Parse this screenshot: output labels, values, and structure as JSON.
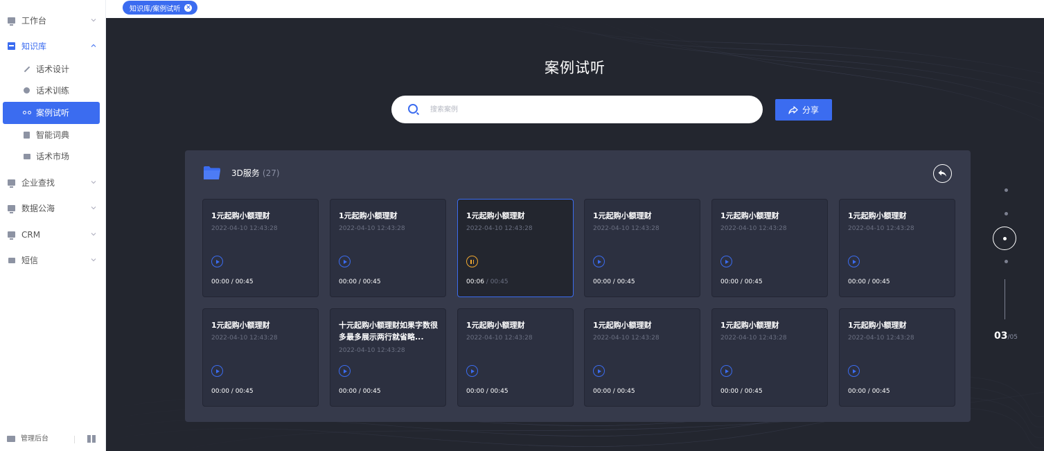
{
  "sidebar": {
    "items": [
      {
        "label": "工作台",
        "icon": "monitor-icon"
      },
      {
        "label": "知识库",
        "icon": "book-icon"
      },
      {
        "label": "话术设计",
        "icon": "pencil-icon"
      },
      {
        "label": "话术训练",
        "icon": "chat-icon"
      },
      {
        "label": "案例试听",
        "icon": "tape-icon"
      },
      {
        "label": "智能词典",
        "icon": "dictionary-icon"
      },
      {
        "label": "话术市场",
        "icon": "market-icon"
      },
      {
        "label": "企业查找",
        "icon": "company-icon"
      },
      {
        "label": "数据公海",
        "icon": "data-icon"
      },
      {
        "label": "CRM",
        "icon": "crm-icon"
      },
      {
        "label": "短信",
        "icon": "sms-icon"
      }
    ],
    "footer_label": "管理后台"
  },
  "tab": {
    "label": "知识库/案例试听"
  },
  "page": {
    "title": "案例试听",
    "search_placeholder": "搜索案例",
    "share_label": "分享"
  },
  "panel": {
    "folder_name": "3D服务",
    "count": "(27)",
    "cards": [
      {
        "title": "1元起购小额理财",
        "date": "2022-04-10 12:43:28",
        "current": "00:00",
        "total": " / 00:45",
        "state": "paused"
      },
      {
        "title": "1元起购小额理财",
        "date": "2022-04-10 12:43:28",
        "current": "00:00",
        "total": " / 00:45",
        "state": "paused"
      },
      {
        "title": "1元起购小额理财",
        "date": "2022-04-10 12:43:28",
        "current": "00:06",
        "total": " / 00:45",
        "state": "playing"
      },
      {
        "title": "1元起购小额理财",
        "date": "2022-04-10 12:43:28",
        "current": "00:00",
        "total": " / 00:45",
        "state": "paused"
      },
      {
        "title": "1元起购小额理财",
        "date": "2022-04-10 12:43:28",
        "current": "00:00",
        "total": " / 00:45",
        "state": "paused"
      },
      {
        "title": "1元起购小额理财",
        "date": "2022-04-10 12:43:28",
        "current": "00:00",
        "total": " / 00:45",
        "state": "paused"
      },
      {
        "title": "1元起购小额理财",
        "date": "2022-04-10 12:43:28",
        "current": "00:00",
        "total": " / 00:45",
        "state": "paused"
      },
      {
        "title": "十元起购小额理财如果字数很多最多展示两行就省略...",
        "date": "2022-04-10 12:43:28",
        "current": "00:00",
        "total": " / 00:45",
        "state": "paused"
      },
      {
        "title": "1元起购小额理财",
        "date": "2022-04-10 12:43:28",
        "current": "00:00",
        "total": " / 00:45",
        "state": "paused"
      },
      {
        "title": "1元起购小额理财",
        "date": "2022-04-10 12:43:28",
        "current": "00:00",
        "total": " / 00:45",
        "state": "paused"
      },
      {
        "title": "1元起购小额理财",
        "date": "2022-04-10 12:43:28",
        "current": "00:00",
        "total": " / 00:45",
        "state": "paused"
      },
      {
        "title": "1元起购小额理财",
        "date": "2022-04-10 12:43:28",
        "current": "00:00",
        "total": " / 00:45",
        "state": "paused"
      }
    ]
  },
  "pager": {
    "current": "03",
    "total": "/05"
  },
  "colors": {
    "accent": "#3b6cf0",
    "playing": "#f0a830",
    "background": "#23262f",
    "panel": "#363a4b"
  }
}
